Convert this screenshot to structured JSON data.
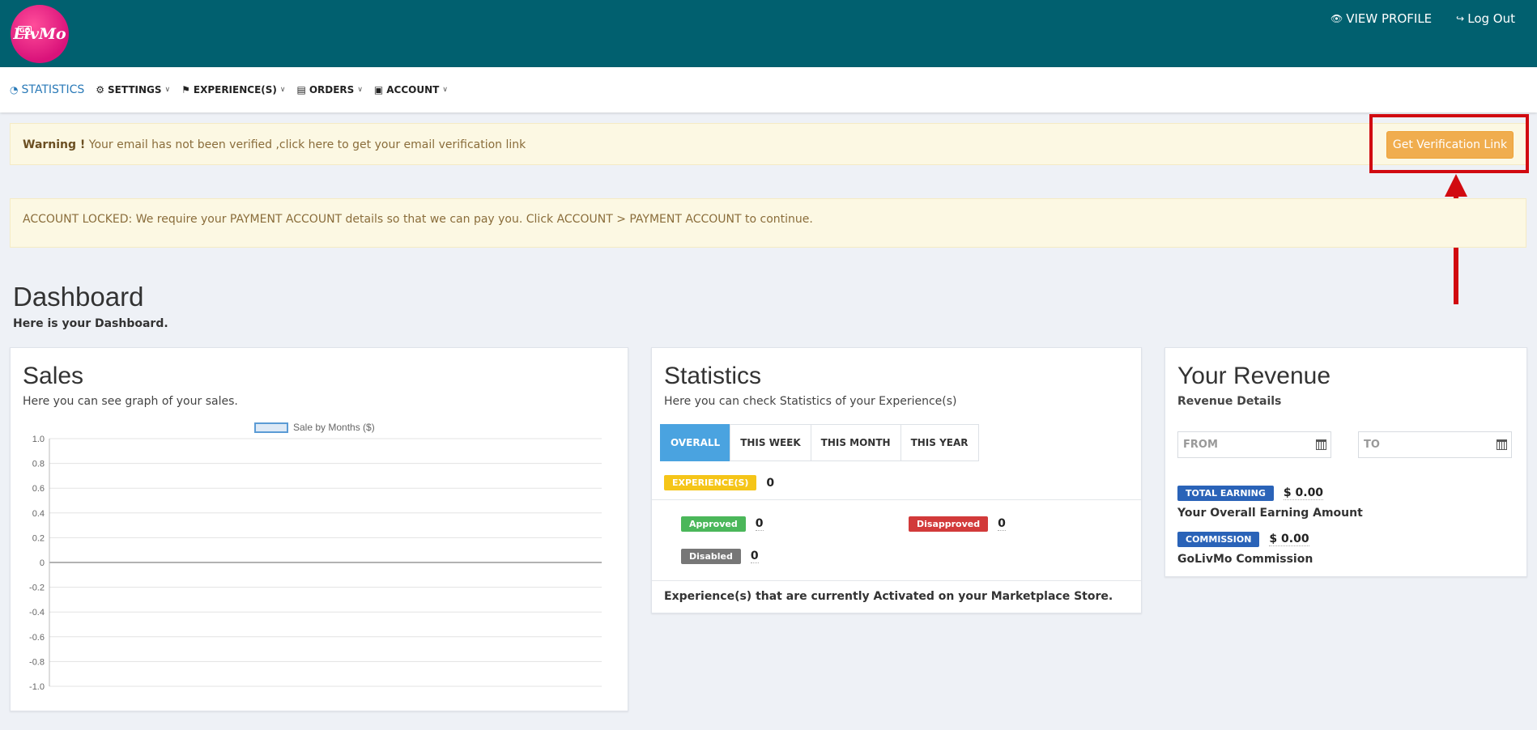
{
  "brand": {
    "logo_text": "LivMo",
    "logo_badge": "GO"
  },
  "topnav": {
    "view_profile": "VIEW PROFILE",
    "logout": "Log Out"
  },
  "menu": [
    {
      "label": "STATISTICS",
      "icon": "dashboard-icon"
    },
    {
      "label": "SETTINGS",
      "icon": "gear-icon"
    },
    {
      "label": "EXPERIENCE(S)",
      "icon": "tag-icon"
    },
    {
      "label": "ORDERS",
      "icon": "clipboard-icon"
    },
    {
      "label": "ACCOUNT",
      "icon": "id-card-icon"
    }
  ],
  "alerts": {
    "warning_strong": "Warning !",
    "warning_text": " Your email has not been verified ,click here to get your email verification link",
    "verify_button": "Get Verification Link",
    "locked_text": "ACCOUNT LOCKED: We require your PAYMENT ACCOUNT details so that we can pay you. Click ACCOUNT > PAYMENT ACCOUNT to continue."
  },
  "dashboard": {
    "title": "Dashboard",
    "subtitle": "Here is your Dashboard."
  },
  "sales": {
    "title": "Sales",
    "subtitle": "Here you can see graph of your sales.",
    "legend": "Sale by Months ($)"
  },
  "chart_data": {
    "type": "bar",
    "title": "",
    "series": [
      {
        "name": "Sale by Months ($)",
        "values": []
      }
    ],
    "categories": [],
    "ylim": [
      -1.0,
      1.0
    ],
    "yticks": [
      "1.0",
      "0.8",
      "0.6",
      "0.4",
      "0.2",
      "0",
      "-0.2",
      "-0.4",
      "-0.6",
      "-0.8",
      "-1.0"
    ],
    "grid": true,
    "legend_position": "top"
  },
  "statistics": {
    "title": "Statistics",
    "subtitle": "Here you can check Statistics of your Experience(s)",
    "tabs": [
      "OVERALL",
      "THIS WEEK",
      "THIS MONTH",
      "THIS YEAR"
    ],
    "experiences_label": "EXPERIENCE(S)",
    "experiences_count": "0",
    "approved_label": "Approved",
    "approved_count": "0",
    "disapproved_label": "Disapproved",
    "disapproved_count": "0",
    "disabled_label": "Disabled",
    "disabled_count": "0",
    "footer": "Experience(s) that are currently Activated on your Marketplace Store."
  },
  "revenue": {
    "title": "Your Revenue",
    "subtitle": "Revenue Details",
    "from_placeholder": "FROM",
    "to_placeholder": "TO",
    "total_label": "TOTAL EARNING",
    "total_value": "$ 0.00",
    "total_caption": "Your Overall Earning Amount",
    "commission_label": "COMMISSION",
    "commission_value": "$ 0.00",
    "commission_caption": "GoLivMo Commission"
  }
}
